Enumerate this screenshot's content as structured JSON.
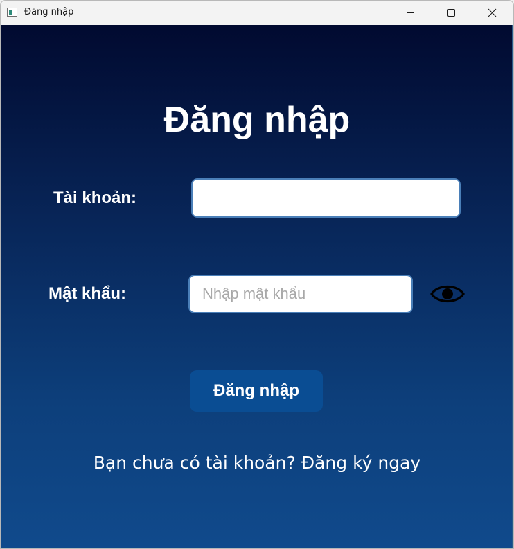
{
  "window": {
    "title": "Đăng nhập",
    "icon": "app-window-icon",
    "controls": [
      "minimize-icon",
      "maximize-icon",
      "close-icon"
    ]
  },
  "form": {
    "heading": "Đăng nhập",
    "username_label": "Tài khoản:",
    "username_value": "",
    "password_label": "Mật khẩu:",
    "password_value": "",
    "password_placeholder": "Nhập mật khẩu",
    "toggle_visibility_icon": "eye-icon",
    "submit_label": "Đăng nhập",
    "register_prompt": "Bạn chưa có tài khoản? Đăng ký ngay"
  },
  "colors": {
    "background_top": "#010a30",
    "background_bottom": "#104a8c",
    "button": "#0a4d93",
    "field_border": "#4a7fb8",
    "text": "#ffffff"
  }
}
